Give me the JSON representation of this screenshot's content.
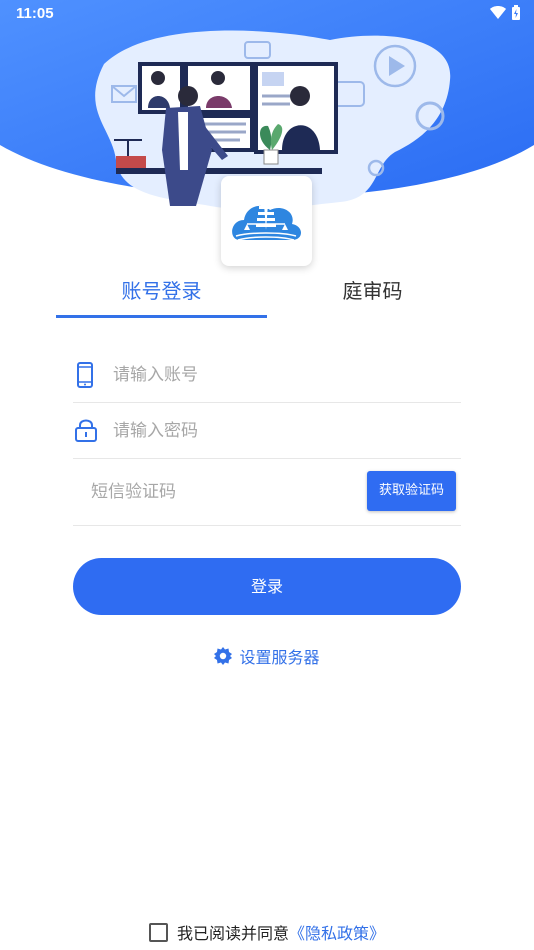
{
  "status_bar": {
    "time": "11:05"
  },
  "tabs": [
    {
      "label": "账号登录",
      "active": true
    },
    {
      "label": "庭审码",
      "active": false
    }
  ],
  "form": {
    "account_placeholder": "请输入账号",
    "password_placeholder": "请输入密码",
    "sms_placeholder": "短信验证码",
    "sms_button": "获取验证码",
    "login_button": "登录"
  },
  "server_setting": "设置服务器",
  "agreement": {
    "text": "我已阅读并同意",
    "link": "《隐私政策》"
  },
  "colors": {
    "primary": "#2f6cf2",
    "accent_text": "#3371e8",
    "header_gradient_start": "#4b8eff",
    "header_gradient_end": "#2b6ff5"
  },
  "icons": [
    "wifi-icon",
    "battery-icon",
    "phone-icon",
    "lock-icon",
    "gear-icon",
    "court-logo-icon",
    "checkbox-icon"
  ]
}
